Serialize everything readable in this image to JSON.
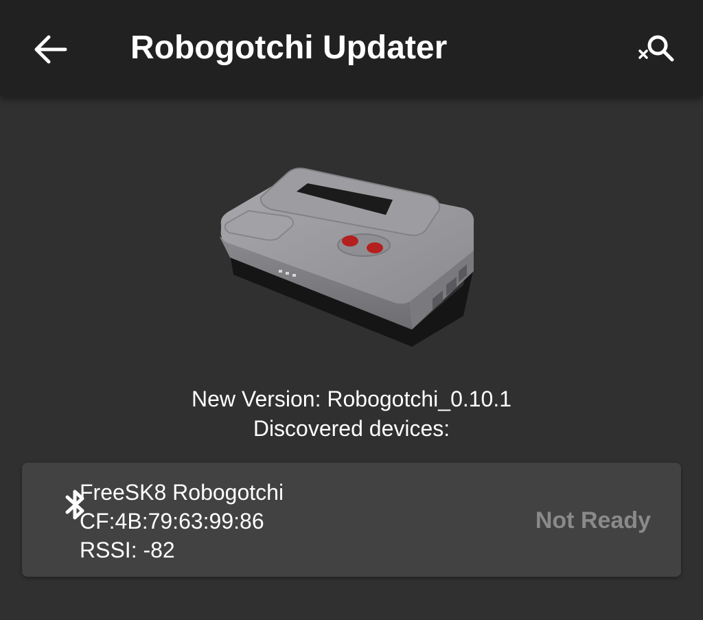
{
  "appbar": {
    "title": "Robogotchi Updater",
    "back_icon": "arrow-left-icon",
    "action_icon": "search-clear-icon"
  },
  "update": {
    "new_version": "New Version: Robogotchi_0.10.1",
    "discovered_label": "Discovered devices:"
  },
  "devices": [
    {
      "name": "FreeSK8 Robogotchi",
      "address": "CF:4B:79:63:99:86",
      "rssi": "RSSI: -82",
      "status": "Not Ready",
      "icon": "bluetooth-icon"
    }
  ],
  "colors": {
    "background": "#303030",
    "appbar": "#212121",
    "card": "#424242",
    "status_text": "#8a8a8a"
  }
}
